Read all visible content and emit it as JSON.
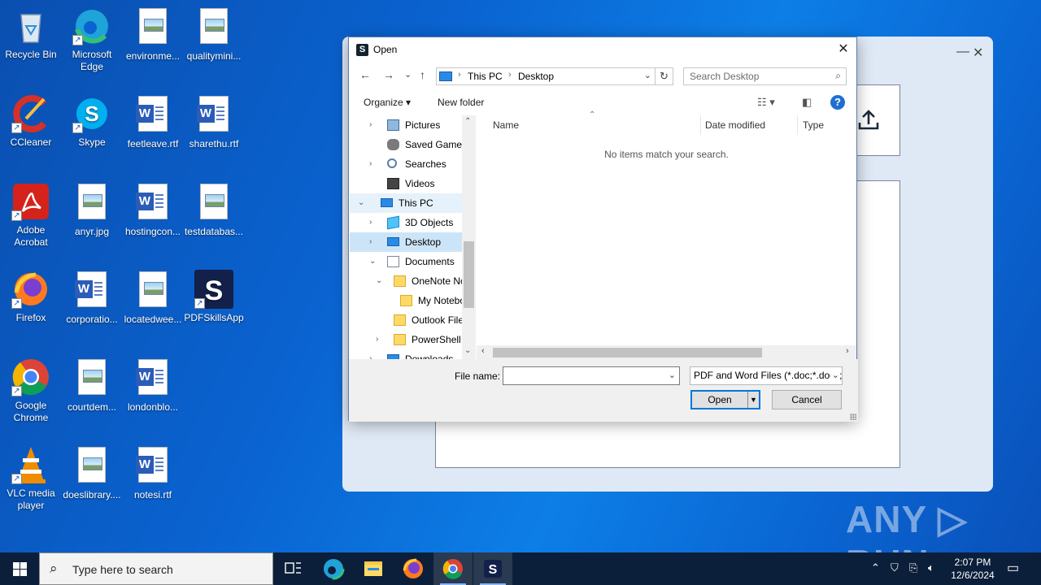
{
  "desktop": {
    "icons": [
      {
        "label": "Recycle Bin",
        "icon": "recycle-bin-icon"
      },
      {
        "label": "Microsoft Edge",
        "icon": "edge-icon"
      },
      {
        "label": "environme...",
        "icon": "image-file-icon"
      },
      {
        "label": "qualitymini...",
        "icon": "image-file-icon"
      },
      {
        "label": "CCleaner",
        "icon": "ccleaner-icon"
      },
      {
        "label": "Skype",
        "icon": "skype-icon"
      },
      {
        "label": "feetleave.rtf",
        "icon": "word-file-icon"
      },
      {
        "label": "sharethu.rtf",
        "icon": "word-file-icon"
      },
      {
        "label": "Adobe Acrobat",
        "icon": "acrobat-icon"
      },
      {
        "label": "anyr.jpg",
        "icon": "image-file-icon"
      },
      {
        "label": "hostingcon...",
        "icon": "word-file-icon"
      },
      {
        "label": "testdatabas...",
        "icon": "image-file-icon"
      },
      {
        "label": "Firefox",
        "icon": "firefox-icon"
      },
      {
        "label": "corporatio...",
        "icon": "word-file-icon"
      },
      {
        "label": "locatedwee...",
        "icon": "image-file-icon"
      },
      {
        "label": "PDFSkillsApp",
        "icon": "pdfskills-icon"
      },
      {
        "label": "Google Chrome",
        "icon": "chrome-icon"
      },
      {
        "label": "courtdem...",
        "icon": "image-file-icon"
      },
      {
        "label": "londonblo...",
        "icon": "word-file-icon"
      },
      {
        "label": "VLC media player",
        "icon": "vlc-icon"
      },
      {
        "label": "doeslibrary....",
        "icon": "image-file-icon"
      },
      {
        "label": "notesi.rtf",
        "icon": "word-file-icon"
      }
    ]
  },
  "background_app": {
    "minimize": "—",
    "close": "✕",
    "upload_icon": "⇧"
  },
  "dialog": {
    "title": "Open",
    "app_icon_letter": "S",
    "close_glyph": "✕",
    "nav": {
      "back": "←",
      "forward": "→",
      "recent": "⌄",
      "up": "↑",
      "refresh": "↻"
    },
    "address": {
      "crumbs": [
        "This PC",
        "Desktop"
      ],
      "sep": "›"
    },
    "search": {
      "placeholder": "Search Desktop"
    },
    "commands": {
      "organize": "Organize ▾",
      "new_folder": "New folder",
      "help": "?"
    },
    "tree": [
      {
        "label": "Pictures",
        "arrow": "›",
        "icon": "pics"
      },
      {
        "label": "Saved Games",
        "arrow": "",
        "icon": "games"
      },
      {
        "label": "Searches",
        "arrow": "›",
        "icon": "search"
      },
      {
        "label": "Videos",
        "arrow": "",
        "icon": "vid"
      },
      {
        "label": "This PC",
        "arrow": "⌄",
        "icon": "pc"
      },
      {
        "label": "3D Objects",
        "arrow": "›",
        "icon": "cube"
      },
      {
        "label": "Desktop",
        "arrow": "›",
        "icon": "desk"
      },
      {
        "label": "Documents",
        "arrow": "⌄",
        "icon": "doc"
      },
      {
        "label": "OneNote Notebooks",
        "arrow": "⌄",
        "icon": "folder"
      },
      {
        "label": "My Notebook",
        "arrow": "",
        "icon": "folder"
      },
      {
        "label": "Outlook Files",
        "arrow": "",
        "icon": "folder"
      },
      {
        "label": "PowerShell",
        "arrow": "›",
        "icon": "folder"
      },
      {
        "label": "Downloads",
        "arrow": "›",
        "icon": "pc"
      }
    ],
    "columns": [
      "Name",
      "Date modified",
      "Type"
    ],
    "empty_message": "No items match your search.",
    "file_name_label": "File name:",
    "file_name_value": "",
    "file_type": "PDF and Word Files (*.doc;*.docx;*.pdf)",
    "open_label": "Open",
    "cancel_label": "Cancel"
  },
  "watermark": "ANY ▷ RUN",
  "taskbar": {
    "search_placeholder": "Type here to search",
    "apps": [
      "task-view",
      "edge",
      "file-explorer",
      "firefox",
      "chrome",
      "pdfskills"
    ],
    "time": "2:07 PM",
    "date": "12/6/2024"
  }
}
